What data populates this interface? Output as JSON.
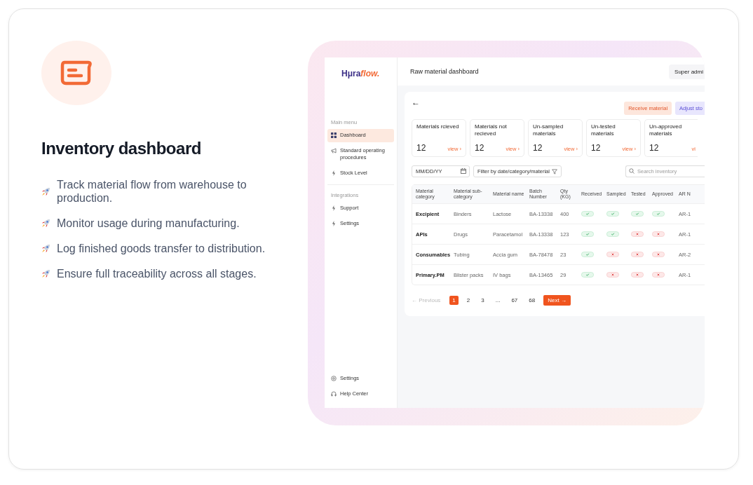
{
  "feature": {
    "title": "Inventory dashboard",
    "bullets": [
      "Track material flow from warehouse to production.",
      "Monitor usage during manufacturing.",
      "Log finished goods transfer to distribution.",
      "Ensure full traceability across all stages."
    ]
  },
  "app": {
    "logo": {
      "first": "Hμra",
      "second": "flow."
    },
    "header_title": "Raw material dashboard",
    "user_button": "Super admi",
    "sidebar": {
      "main_label": "Main menu",
      "main_items": [
        {
          "label": "Dashboard",
          "selected": true
        },
        {
          "label": "Standard operating procedures",
          "selected": false
        },
        {
          "label": "Stock Level",
          "selected": false
        }
      ],
      "integrations_label": "Integrations",
      "integration_items": [
        {
          "label": "Support",
          "selected": false
        },
        {
          "label": "Settings",
          "selected": false
        }
      ],
      "bottom_items": [
        {
          "label": "Settings"
        },
        {
          "label": "Help Center"
        }
      ]
    },
    "back": "←",
    "actions": [
      {
        "label": "Receive material",
        "kind": "primary"
      },
      {
        "label": "Adjust sto",
        "kind": "secondary"
      }
    ],
    "stats": [
      {
        "label": "Materials rcieved",
        "value": "12",
        "link": "view ›"
      },
      {
        "label": "Materials not recieved",
        "value": "12",
        "link": "view ›"
      },
      {
        "label": "Un-sampled materials",
        "value": "12",
        "link": "view ›"
      },
      {
        "label": "Un-tested materials",
        "value": "12",
        "link": "view ›"
      },
      {
        "label": "Un-approved materials",
        "value": "12",
        "link": "vi"
      }
    ],
    "date_field": {
      "placeholder": "MM/DD/YY"
    },
    "filter": "Filter by date/category/material",
    "search": {
      "placeholder": "Search inventory"
    },
    "table": {
      "columns": [
        "Material category",
        "Material sub-category",
        "Material name",
        "Batch Number",
        "Qty (KG)",
        "Received",
        "Sampled",
        "Tested",
        "Approved",
        "AR N"
      ],
      "rows": [
        {
          "category": "Excipient",
          "sub_category": "Binders",
          "name": "Lactose",
          "batch": "BA-13338",
          "qty": "400",
          "received": true,
          "sampled": true,
          "tested": true,
          "approved": true,
          "ar": "AR-1"
        },
        {
          "category": "APIs",
          "sub_category": "Drugs",
          "name": "Paracetamol",
          "batch": "BA-13338",
          "qty": "123",
          "received": true,
          "sampled": true,
          "tested": false,
          "approved": false,
          "ar": "AR-1"
        },
        {
          "category": "Consumables",
          "sub_category": "Tubing",
          "name": "Accia gum",
          "batch": "BA-78478",
          "qty": "23",
          "received": true,
          "sampled": false,
          "tested": false,
          "approved": false,
          "ar": "AR-2"
        },
        {
          "category": "Primary.PM",
          "sub_category": "Blister packs",
          "name": "IV bags",
          "batch": "BA-13465",
          "qty": "29",
          "received": true,
          "sampled": false,
          "tested": false,
          "approved": false,
          "ar": "AR-1"
        }
      ]
    },
    "pagination": {
      "previous": {
        "label": "← Previous",
        "disabled": true
      },
      "pages": [
        {
          "label": "1",
          "selected": true
        },
        {
          "label": "2",
          "selected": false
        },
        {
          "label": "3",
          "selected": false
        },
        {
          "label": "...",
          "selected": false
        },
        {
          "label": "67",
          "selected": false
        },
        {
          "label": "68",
          "selected": false
        }
      ],
      "next": "Next →"
    }
  }
}
